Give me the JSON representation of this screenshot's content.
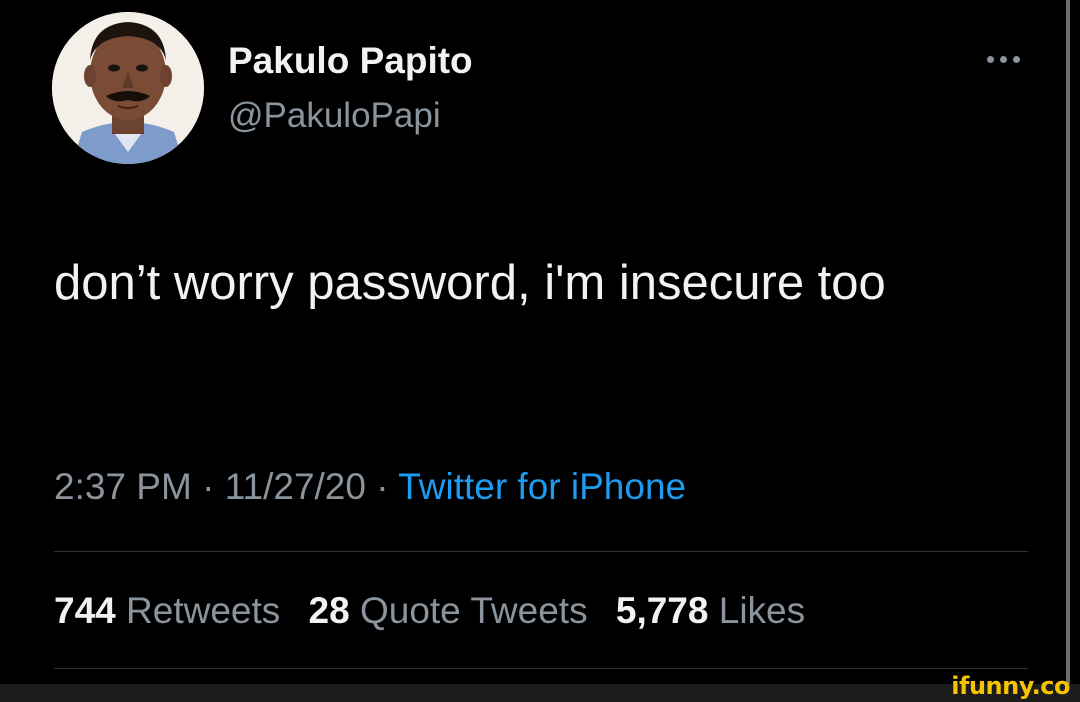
{
  "author": {
    "display_name": "Pakulo Papito",
    "handle": "@PakuloPapi",
    "avatar_icon": "profile-photo"
  },
  "more_icon": "ellipsis-icon",
  "tweet": {
    "text": "don’t worry password, i'm insecure too"
  },
  "meta": {
    "time": "2:37 PM",
    "sep1": " · ",
    "date": "11/27/20",
    "sep2": " · ",
    "source": "Twitter for iPhone"
  },
  "stats": {
    "retweets_count": "744",
    "retweets_label": "Retweets",
    "quotes_count": "28",
    "quotes_label": "Quote Tweets",
    "likes_count": "5,778",
    "likes_label": "Likes"
  },
  "watermark": "ifunny.co",
  "colors": {
    "background": "#000000",
    "primary_text": "#f2f2f2",
    "secondary_text": "#8b949c",
    "link": "#1d9bf0",
    "divider": "#2f3336",
    "watermark": "#f5c400"
  }
}
